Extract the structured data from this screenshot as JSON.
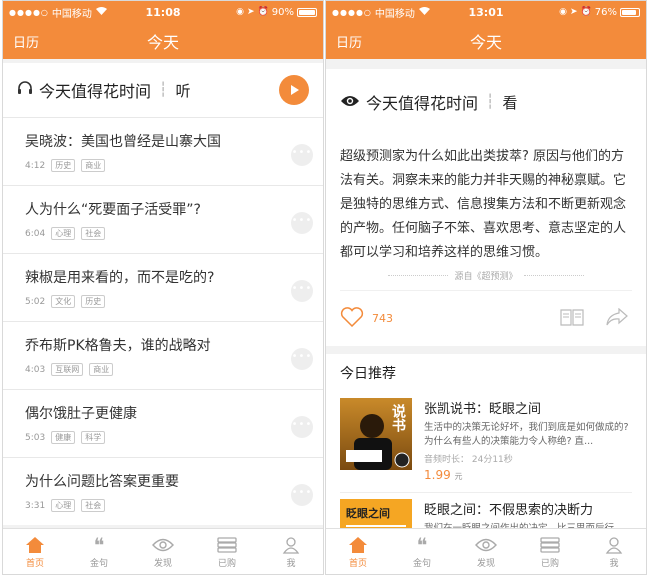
{
  "left_screen": {
    "status": {
      "signal": "●●●●○",
      "carrier": "中国移动",
      "time": "11:08",
      "battery": "90%",
      "battery_level": 0.9
    },
    "nav": {
      "calendar": "日历",
      "title": "今天"
    },
    "header": {
      "icon": "headphones-icon",
      "title": "今天值得花时间",
      "mode": "听"
    },
    "items": [
      {
        "title": "吴晓波：美国也曾经是山寨大国",
        "duration": "4:12",
        "tags": [
          "历史",
          "商业"
        ]
      },
      {
        "title": "人为什么“死要面子活受罪”?",
        "duration": "6:04",
        "tags": [
          "心理",
          "社会"
        ]
      },
      {
        "title": "辣椒是用来看的，而不是吃的?",
        "duration": "5:02",
        "tags": [
          "文化",
          "历史"
        ]
      },
      {
        "title": "乔布斯PK格鲁夫，谁的战略对",
        "duration": "4:03",
        "tags": [
          "互联网",
          "商业"
        ]
      },
      {
        "title": "偶尔饿肚子更健康",
        "duration": "5:03",
        "tags": [
          "健康",
          "科学"
        ]
      },
      {
        "title": "为什么问题比答案更重要",
        "duration": "3:31",
        "tags": [
          "心理",
          "社会"
        ]
      }
    ],
    "tabs": [
      {
        "label": "首页",
        "icon": "home-icon",
        "active": true
      },
      {
        "label": "金句",
        "icon": "quote-icon",
        "active": false
      },
      {
        "label": "发现",
        "icon": "eye-icon",
        "active": false
      },
      {
        "label": "已购",
        "icon": "purchased-icon",
        "active": false
      },
      {
        "label": "我",
        "icon": "user-icon",
        "active": false
      }
    ]
  },
  "right_screen": {
    "status": {
      "signal": "●●●●○",
      "carrier": "中国移动",
      "time": "13:01",
      "battery": "76%",
      "battery_level": 0.76
    },
    "nav": {
      "calendar": "日历",
      "title": "今天"
    },
    "header": {
      "icon": "eye-icon",
      "title": "今天值得花时间",
      "mode": "看"
    },
    "quote": "超级预测家为什么如此出类拔萃? 原因与他们的方法有关。洞察未来的能力并非天赐的神秘禀赋。它是独特的思维方式、信息搜集方法和不断更新观念的产物。任何脑子不笨、喜欢思考、意志坚定的人都可以学习和培养这样的思维习惯。",
    "source": "源自《超预测》",
    "likes": "743",
    "recommend_title": "今日推荐",
    "recommendations": [
      {
        "title": "张凯说书：眨眼之间",
        "desc": "生活中的决策无论好坏，我们到底是如何做成的? 为什么有些人的决策能力令人称绝? 直...",
        "duration": "音频时长： 24分11秒",
        "price": "1.99",
        "unit": "元",
        "cover_text": "说书"
      },
      {
        "title": "眨眼之间：不假思索的决断力",
        "desc": "我们在一眨眼之间作出的决定，比三思而后行",
        "cover_text": "眨眼之间"
      }
    ],
    "tabs": [
      {
        "label": "首页",
        "icon": "home-icon",
        "active": true
      },
      {
        "label": "金句",
        "icon": "quote-icon",
        "active": false
      },
      {
        "label": "发现",
        "icon": "eye-icon",
        "active": false
      },
      {
        "label": "已购",
        "icon": "purchased-icon",
        "active": false
      },
      {
        "label": "我",
        "icon": "user-icon",
        "active": false
      }
    ]
  },
  "colors": {
    "accent": "#f38b3b",
    "background": "#f2f2f2"
  }
}
